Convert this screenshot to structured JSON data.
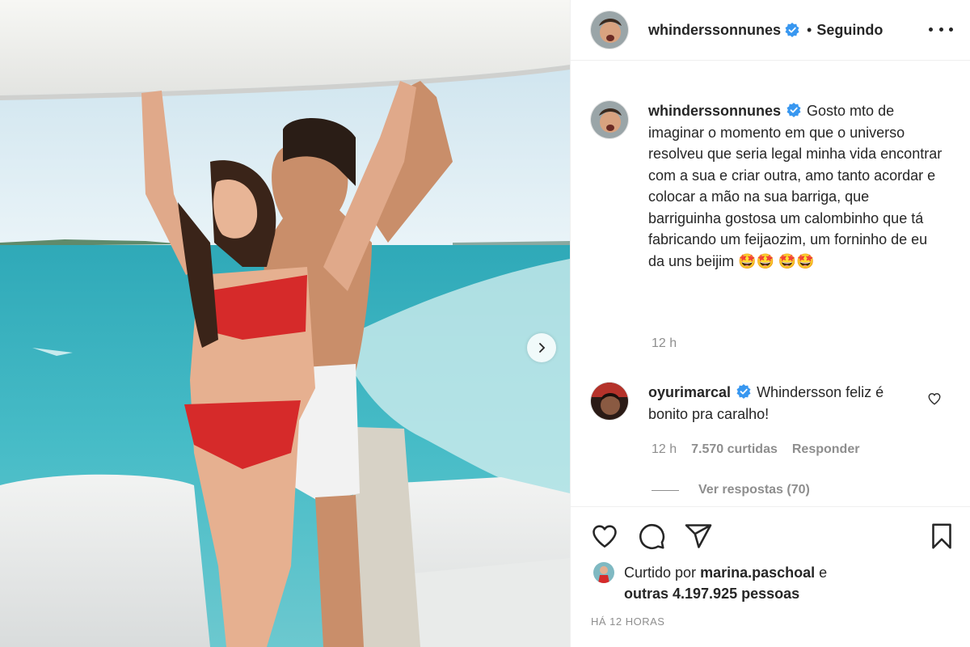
{
  "post": {
    "username": "whinderssonnunes",
    "follow_label": "Seguindo",
    "dot": "•",
    "caption": "Gosto mto de imaginar o momento em que o universo resolveu que seria legal minha vida encontrar com a sua e criar outra, amo tanto acordar e colocar a mão na sua barriga, que barriguinha gostosa um calombinho que tá fabricando um feijaozim, um forninho de eu da uns beijim 🤩🤩 🤩🤩",
    "caption_time": "12 h"
  },
  "comment": {
    "username": "oyurimarcal",
    "text": "Whindersson feliz é bonito pra caralho!",
    "time": "12 h",
    "likes": "7.570 curtidas",
    "reply_label": "Responder",
    "view_replies": "Ver respostas (70)"
  },
  "likes": {
    "prefix": "Curtido por",
    "user": "marina.paschoal",
    "and": "e",
    "others": "outras 4.197.925 pessoas"
  },
  "timestamp": "HÁ 12 HORAS",
  "icons": {
    "header_avatar": "avatar",
    "verified": "verified-badge-icon",
    "more": "more-options-icon",
    "next": "chevron-right-icon",
    "like": "heart-icon",
    "comment": "comment-icon",
    "share": "paper-plane-icon",
    "save": "bookmark-icon"
  },
  "colors": {
    "verified": "#3897f0",
    "text": "#262626",
    "secondary": "#8e8e8e",
    "divider": "#efefef",
    "sea": "#4fb9c4",
    "sky": "#dbeef6"
  }
}
